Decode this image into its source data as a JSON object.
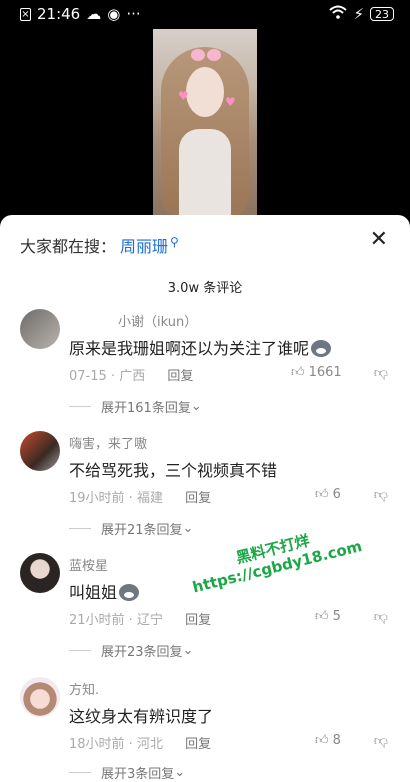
{
  "status_bar": {
    "time": "21:46",
    "extra_icons": "···",
    "battery": "23"
  },
  "sheet": {
    "search_prefix": "大家都在搜：",
    "search_term": "周丽珊",
    "comment_count": "3.0w 条评论",
    "comments": [
      {
        "user": "小谢（ikun）",
        "text": "原来是我珊姐啊还以为关注了谁呢",
        "time": "07-15",
        "location": "广西",
        "reply": "回复",
        "likes": "1661",
        "expand": "展开161条回复"
      },
      {
        "user": "嗨害，来了嗷",
        "text": "不给骂死我，三个视频真不错",
        "time": "19小时前",
        "location": "福建",
        "reply": "回复",
        "likes": "6",
        "expand": "展开21条回复"
      },
      {
        "user": "蓝桉星",
        "text": "叫姐姐",
        "time": "21小时前",
        "location": "辽宁",
        "reply": "回复",
        "likes": "5",
        "expand": "展开23条回复"
      },
      {
        "user": "方知.",
        "text": "这纹身太有辨识度了",
        "time": "18小时前",
        "location": "河北",
        "reply": "回复",
        "likes": "8",
        "expand": "展开3条回复"
      }
    ]
  },
  "watermark": {
    "line1": "黑料不打烊",
    "line2": "https://cgbdy18.com"
  }
}
